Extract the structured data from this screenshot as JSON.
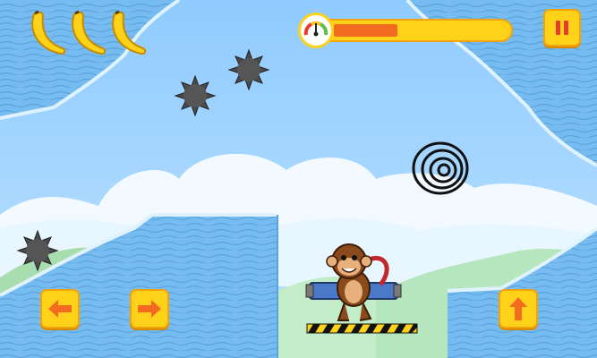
{
  "game": {
    "banana_count": 3,
    "fuel_level": 0.36,
    "colors": {
      "sky": "#A9D9FF",
      "terrain": "#6CB6EE",
      "button": "#FFD21A",
      "arrow": "#F26B21",
      "fuel_fill": "#F26B21"
    }
  },
  "hud": {
    "icons": {
      "pause": "pause-icon",
      "left": "arrow-left-icon",
      "right": "arrow-right-icon",
      "up": "arrow-up-icon",
      "gauge": "fuel-gauge-icon",
      "banana": "banana-icon"
    }
  }
}
